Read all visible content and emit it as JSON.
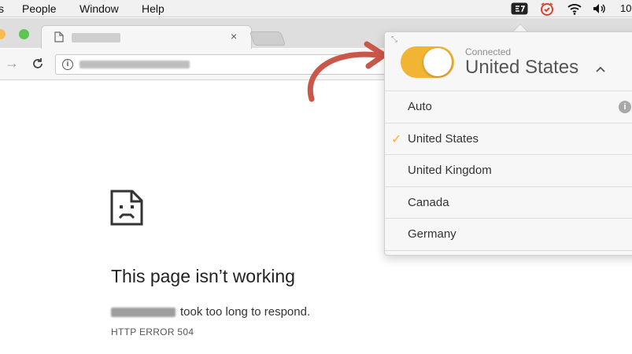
{
  "menubar": {
    "items": [
      "s",
      "People",
      "Window",
      "Help"
    ],
    "clock": "10"
  },
  "browser": {
    "tab_close": "×"
  },
  "error_page": {
    "title": "This page isn’t working",
    "message": "took too long to respond.",
    "code": "HTTP ERROR 504"
  },
  "vpn": {
    "status": "Connected",
    "current_country": "United States",
    "chevron": "^",
    "options": [
      {
        "label": "Auto"
      },
      {
        "label": "United States",
        "selected": true
      },
      {
        "label": "United Kingdom"
      },
      {
        "label": "Canada"
      },
      {
        "label": "Germany"
      }
    ],
    "info_glyph": "i",
    "check_glyph": "✓",
    "accent_color": "#f1b433"
  },
  "arrow_color": "#c9584a"
}
